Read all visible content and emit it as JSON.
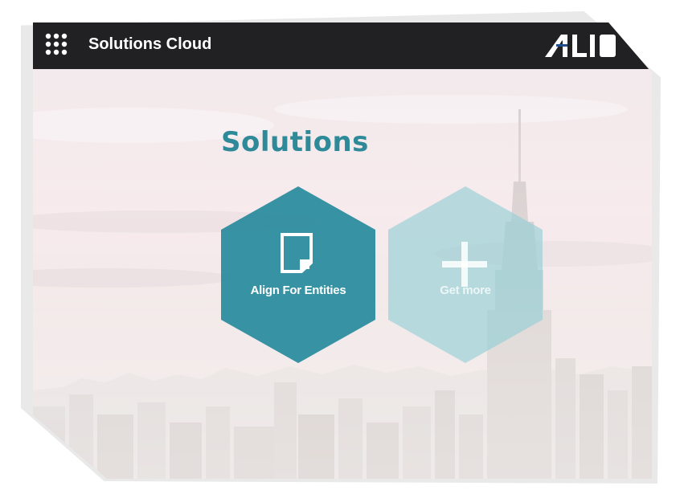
{
  "app": {
    "title": "Solutions Cloud",
    "menu_icon": "app-grid-icon",
    "logo_text": "ALI"
  },
  "main": {
    "heading": "Solutions",
    "tiles": [
      {
        "label": "Align For Entities",
        "icon": "document-icon"
      },
      {
        "label": "Get more",
        "icon": "plus-icon"
      }
    ]
  },
  "colors": {
    "header_bg": "#212124",
    "accent": "#2e8a98",
    "tile_primary": "#2f8ea0",
    "tile_secondary": "#8fcfd5"
  }
}
